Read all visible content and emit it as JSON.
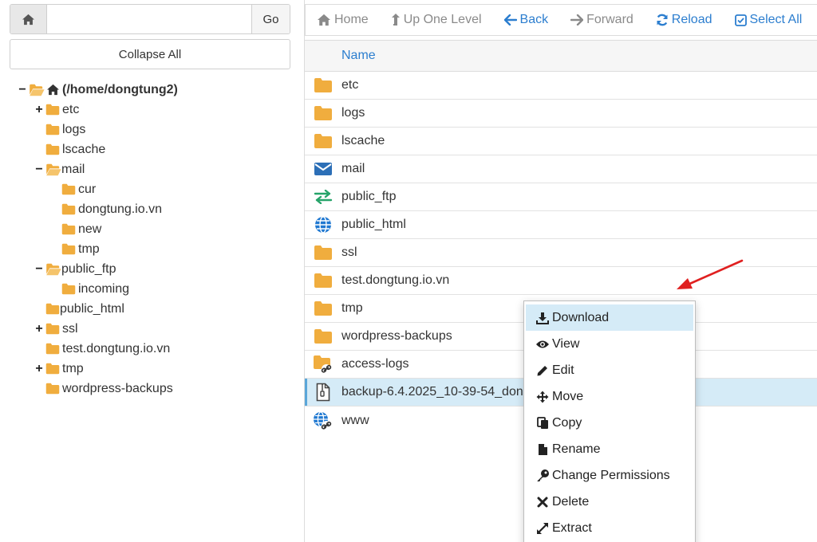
{
  "path_bar": {
    "value": "",
    "go_label": "Go"
  },
  "tree": {
    "collapse_label": "Collapse All",
    "root": "(/home/dongtung2)",
    "items": [
      {
        "label": "etc",
        "toggle": "+"
      },
      {
        "label": "logs",
        "toggle": ""
      },
      {
        "label": "lscache",
        "toggle": ""
      },
      {
        "label": "mail",
        "toggle": "−"
      },
      {
        "label": "cur",
        "toggle": ""
      },
      {
        "label": "dongtung.io.vn",
        "toggle": ""
      },
      {
        "label": "new",
        "toggle": ""
      },
      {
        "label": "tmp",
        "toggle": ""
      },
      {
        "label": "public_ftp",
        "toggle": "−"
      },
      {
        "label": "incoming",
        "toggle": ""
      },
      {
        "label": "public_html",
        "toggle": ""
      },
      {
        "label": "ssl",
        "toggle": "+"
      },
      {
        "label": "test.dongtung.io.vn",
        "toggle": ""
      },
      {
        "label": "tmp",
        "toggle": "+"
      },
      {
        "label": "wordpress-backups",
        "toggle": ""
      }
    ]
  },
  "toolbar": {
    "home": "Home",
    "up": "Up One Level",
    "back": "Back",
    "forward": "Forward",
    "reload": "Reload",
    "select_all": "Select All"
  },
  "list": {
    "header": "Name",
    "rows": [
      {
        "name": "etc",
        "icon": "folder-icon"
      },
      {
        "name": "logs",
        "icon": "folder-icon"
      },
      {
        "name": "lscache",
        "icon": "folder-icon"
      },
      {
        "name": "mail",
        "icon": "envelope-icon"
      },
      {
        "name": "public_ftp",
        "icon": "exchange-icon"
      },
      {
        "name": "public_html",
        "icon": "globe-icon"
      },
      {
        "name": "ssl",
        "icon": "folder-icon"
      },
      {
        "name": "test.dongtung.io.vn",
        "icon": "folder-icon"
      },
      {
        "name": "tmp",
        "icon": "folder-icon"
      },
      {
        "name": "wordpress-backups",
        "icon": "folder-icon"
      },
      {
        "name": "access-logs",
        "icon": "folder-link-icon"
      },
      {
        "name": "backup-6.4.2025_10-39-54_don",
        "icon": "archive-file-icon"
      },
      {
        "name": "www",
        "icon": "globe-link-icon"
      }
    ]
  },
  "context_menu": {
    "download": "Download",
    "view": "View",
    "edit": "Edit",
    "move": "Move",
    "copy": "Copy",
    "rename": "Rename",
    "permissions": "Change Permissions",
    "delete": "Delete",
    "extract": "Extract"
  },
  "colors": {
    "folder": "#f0ad3e",
    "accent": "#2c7ecf",
    "selected_row": "#d5ebf7",
    "arrow": "#e02020"
  }
}
